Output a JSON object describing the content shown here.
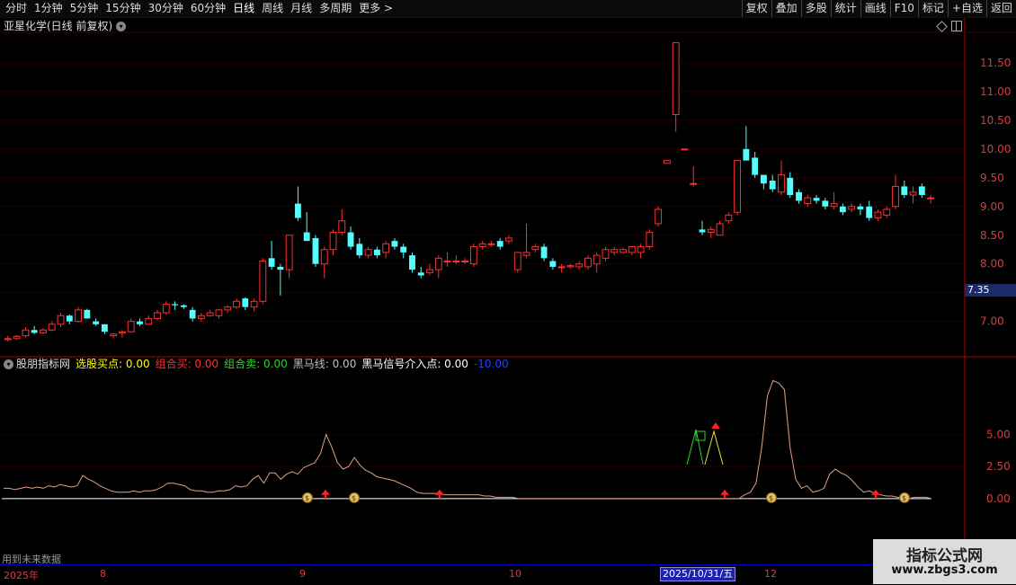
{
  "toolbar": {
    "periods": [
      "分时",
      "1分钟",
      "5分钟",
      "15分钟",
      "30分钟",
      "60分钟",
      "日线",
      "周线",
      "月线",
      "多周期",
      "更多 >"
    ],
    "active": "日线",
    "right": [
      "复权",
      "叠加",
      "多股",
      "统计",
      "画线",
      "F10",
      "标记",
      "+自选",
      "返回"
    ]
  },
  "main_chart": {
    "title": "亚星化学(日线 前复权)",
    "current_price_tag": "7.35",
    "y_ticks": [
      "11.50",
      "11.00",
      "10.50",
      "10.00",
      "9.50",
      "9.00",
      "8.50",
      "8.00",
      "7.50",
      "7.00"
    ],
    "y_tick_values": [
      11.5,
      11.0,
      10.5,
      10.0,
      9.5,
      9.0,
      8.5,
      8.0,
      7.5,
      7.0
    ],
    "ylim": [
      6.4,
      12.0
    ],
    "candles": [
      [
        6.7,
        6.75,
        6.65,
        6.7
      ],
      [
        6.7,
        6.76,
        6.68,
        6.74
      ],
      [
        6.75,
        6.9,
        6.72,
        6.85
      ],
      [
        6.85,
        6.92,
        6.78,
        6.8
      ],
      [
        6.8,
        6.88,
        6.78,
        6.85
      ],
      [
        6.85,
        7.0,
        6.83,
        6.95
      ],
      [
        6.95,
        7.15,
        6.9,
        7.1
      ],
      [
        7.1,
        7.12,
        6.95,
        7.0
      ],
      [
        7.0,
        7.25,
        6.98,
        7.2
      ],
      [
        7.2,
        7.22,
        7.05,
        7.05
      ],
      [
        7.0,
        7.05,
        6.92,
        6.95
      ],
      [
        6.95,
        6.95,
        6.78,
        6.82
      ],
      [
        6.75,
        6.8,
        6.7,
        6.78
      ],
      [
        6.8,
        6.85,
        6.72,
        6.82
      ],
      [
        6.82,
        7.05,
        6.8,
        7.0
      ],
      [
        7.0,
        7.05,
        6.92,
        6.95
      ],
      [
        6.95,
        7.1,
        6.95,
        7.05
      ],
      [
        7.05,
        7.2,
        7.02,
        7.15
      ],
      [
        7.15,
        7.35,
        7.12,
        7.3
      ],
      [
        7.3,
        7.35,
        7.2,
        7.28
      ],
      [
        7.28,
        7.3,
        7.22,
        7.25
      ],
      [
        7.2,
        7.25,
        7.0,
        7.05
      ],
      [
        7.05,
        7.15,
        7.0,
        7.1
      ],
      [
        7.1,
        7.2,
        7.08,
        7.15
      ],
      [
        7.1,
        7.22,
        7.05,
        7.2
      ],
      [
        7.2,
        7.28,
        7.15,
        7.25
      ],
      [
        7.25,
        7.4,
        7.22,
        7.35
      ],
      [
        7.4,
        7.42,
        7.2,
        7.25
      ],
      [
        7.25,
        7.4,
        7.18,
        7.35
      ],
      [
        7.35,
        8.1,
        7.3,
        8.05
      ],
      [
        8.1,
        8.4,
        7.9,
        7.95
      ],
      [
        7.95,
        8.0,
        7.45,
        7.9
      ],
      [
        7.9,
        8.5,
        7.75,
        8.5
      ],
      [
        9.05,
        9.35,
        8.75,
        8.8
      ],
      [
        8.55,
        8.9,
        8.4,
        8.4
      ],
      [
        8.45,
        8.5,
        7.95,
        8.0
      ],
      [
        8.0,
        8.3,
        7.75,
        8.25
      ],
      [
        8.25,
        8.6,
        8.15,
        8.55
      ],
      [
        8.55,
        8.95,
        8.5,
        8.75
      ],
      [
        8.55,
        8.65,
        8.25,
        8.3
      ],
      [
        8.35,
        8.45,
        8.1,
        8.15
      ],
      [
        8.15,
        8.3,
        8.1,
        8.25
      ],
      [
        8.25,
        8.3,
        8.1,
        8.15
      ],
      [
        8.2,
        8.4,
        8.1,
        8.35
      ],
      [
        8.4,
        8.45,
        8.25,
        8.3
      ],
      [
        8.3,
        8.35,
        8.1,
        8.2
      ],
      [
        8.15,
        8.2,
        7.85,
        7.9
      ],
      [
        7.85,
        7.95,
        7.75,
        7.8
      ],
      [
        7.85,
        8.0,
        7.8,
        7.9
      ],
      [
        7.9,
        8.15,
        7.75,
        8.1
      ],
      [
        8.05,
        8.2,
        7.95,
        8.05
      ],
      [
        8.05,
        8.15,
        8.0,
        8.05
      ],
      [
        8.05,
        8.1,
        8.0,
        8.05
      ],
      [
        8.0,
        8.35,
        7.95,
        8.3
      ],
      [
        8.3,
        8.4,
        8.25,
        8.35
      ],
      [
        8.35,
        8.4,
        8.3,
        8.35
      ],
      [
        8.4,
        8.45,
        8.25,
        8.3
      ],
      [
        8.4,
        8.5,
        8.35,
        8.45
      ],
      [
        7.9,
        8.2,
        7.85,
        8.2
      ],
      [
        8.15,
        8.7,
        8.1,
        8.2
      ],
      [
        8.25,
        8.35,
        8.2,
        8.3
      ],
      [
        8.3,
        8.35,
        8.05,
        8.1
      ],
      [
        8.05,
        8.1,
        7.9,
        7.95
      ],
      [
        7.95,
        8.0,
        7.85,
        7.95
      ],
      [
        7.95,
        8.0,
        7.92,
        7.97
      ],
      [
        7.95,
        8.05,
        7.9,
        8.0
      ],
      [
        7.95,
        8.15,
        7.9,
        8.1
      ],
      [
        8.0,
        8.2,
        7.85,
        8.15
      ],
      [
        8.1,
        8.3,
        8.05,
        8.25
      ],
      [
        8.2,
        8.3,
        8.15,
        8.25
      ],
      [
        8.2,
        8.28,
        8.18,
        8.25
      ],
      [
        8.2,
        8.3,
        8.15,
        8.3
      ],
      [
        8.2,
        8.35,
        8.1,
        8.3
      ],
      [
        8.3,
        8.6,
        8.25,
        8.55
      ],
      [
        8.7,
        9.0,
        8.65,
        8.95
      ],
      [
        9.75,
        9.8,
        9.75,
        9.8
      ],
      [
        10.6,
        11.85,
        10.3,
        11.85
      ],
      [
        10.0,
        10.0,
        10.0,
        10.0
      ],
      [
        9.4,
        9.7,
        9.35,
        9.4
      ],
      [
        8.6,
        8.75,
        8.5,
        8.55
      ],
      [
        8.55,
        8.65,
        8.45,
        8.6
      ],
      [
        8.5,
        8.75,
        8.5,
        8.7
      ],
      [
        8.75,
        8.9,
        8.7,
        8.85
      ],
      [
        8.9,
        9.8,
        8.85,
        9.8
      ],
      [
        10.0,
        10.4,
        9.8,
        9.8
      ],
      [
        9.85,
        9.95,
        9.5,
        9.55
      ],
      [
        9.55,
        9.55,
        9.3,
        9.4
      ],
      [
        9.45,
        9.55,
        9.25,
        9.3
      ],
      [
        9.25,
        9.8,
        9.2,
        9.55
      ],
      [
        9.5,
        9.6,
        9.15,
        9.2
      ],
      [
        9.25,
        9.3,
        9.05,
        9.1
      ],
      [
        9.05,
        9.2,
        9.0,
        9.15
      ],
      [
        9.15,
        9.2,
        9.05,
        9.1
      ],
      [
        9.1,
        9.15,
        8.95,
        9.0
      ],
      [
        9.0,
        9.25,
        8.95,
        9.05
      ],
      [
        9.0,
        9.05,
        8.85,
        8.9
      ],
      [
        8.95,
        9.05,
        8.9,
        9.0
      ],
      [
        9.0,
        9.05,
        8.85,
        8.95
      ],
      [
        9.0,
        9.1,
        8.75,
        8.8
      ],
      [
        8.8,
        8.95,
        8.75,
        8.9
      ],
      [
        8.85,
        9.0,
        8.8,
        8.95
      ],
      [
        9.0,
        9.55,
        8.95,
        9.35
      ],
      [
        9.35,
        9.45,
        9.15,
        9.2
      ],
      [
        9.2,
        9.35,
        9.05,
        9.25
      ],
      [
        9.35,
        9.4,
        9.15,
        9.2
      ],
      [
        9.15,
        9.2,
        9.05,
        9.15
      ]
    ],
    "current_price": 7.35
  },
  "indicator": {
    "name": "股朋指标网",
    "items": [
      {
        "label": "选股买点: 0.00",
        "color": "#ffff00"
      },
      {
        "label": "组合买: 0.00",
        "color": "#ff3030"
      },
      {
        "label": "组合卖: 0.00",
        "color": "#30d030"
      },
      {
        "label": "黑马线: 0.00",
        "color": "#c0c0c0"
      },
      {
        "label": "黑马信号介入点: 0.00",
        "color": "#ffffff"
      },
      {
        "label": "-10.00",
        "color": "#2040ff"
      }
    ],
    "y_ticks": [
      "5.00",
      "2.50",
      "0.00"
    ],
    "y_tick_values": [
      5.0,
      2.5,
      0.0
    ],
    "ylim": [
      -4,
      10
    ],
    "line": [
      0.8,
      0.8,
      0.7,
      0.8,
      0.9,
      0.8,
      0.9,
      0.8,
      1.0,
      0.9,
      1.1,
      1.0,
      0.9,
      1.0,
      1.8,
      1.5,
      1.3,
      1.0,
      0.8,
      0.6,
      0.5,
      0.5,
      0.5,
      0.6,
      0.5,
      0.6,
      0.6,
      0.7,
      0.9,
      1.2,
      1.2,
      1.1,
      1.0,
      0.7,
      0.6,
      0.6,
      0.5,
      0.5,
      0.6,
      0.6,
      0.7,
      1.0,
      0.9,
      1.0,
      1.5,
      1.8,
      1.2,
      2.0,
      2.0,
      1.5,
      1.9,
      2.1,
      1.9,
      2.4,
      2.6,
      2.8,
      3.5,
      5.0,
      4.0,
      2.8,
      2.3,
      2.5,
      3.2,
      2.6,
      2.2,
      2.0,
      1.7,
      1.6,
      1.5,
      1.4,
      1.2,
      1.0,
      0.8,
      0.5,
      0.4,
      0.4,
      0.4,
      0.4,
      0.3,
      0.3,
      0.3,
      0.3,
      0.3,
      0.3,
      0.3,
      0.2,
      0.2,
      0.1,
      0.1,
      0.1,
      0.1,
      0.0,
      0.0,
      0.0,
      0.0,
      0.0,
      0.0,
      0.0,
      0.0,
      0.0,
      0.0,
      0.0,
      0.0,
      0.0,
      0.0,
      0.0,
      0.0,
      0.0,
      0.0,
      0.0,
      0.0,
      0.0,
      0.0,
      0.0,
      0.0,
      0.0,
      0.0,
      0.0,
      0.0,
      0.0,
      0.0,
      0.0,
      0.0,
      0.0,
      0.0,
      0.0,
      0.0,
      0.0,
      0.0,
      0.0,
      0.0,
      0.3,
      0.5,
      1.2,
      4.0,
      8.0,
      9.2,
      9.0,
      8.5,
      4.0,
      1.5,
      0.8,
      1.0,
      0.5,
      0.6,
      0.8,
      1.9,
      2.3,
      2.0,
      1.8,
      1.4,
      0.9,
      0.5,
      0.6,
      0.4,
      0.3,
      0.2,
      0.2,
      0.1,
      0.0,
      0.0,
      0.1,
      0.1,
      0.1,
      0.0
    ]
  },
  "bottom": {
    "future_data": "用到未来数据",
    "dates": [
      "2025年",
      "8",
      "9",
      "10",
      "2025/10/31/五",
      "12"
    ],
    "watermark_line1": "指标公式网",
    "watermark_line2": "www.zbgs3.com"
  }
}
